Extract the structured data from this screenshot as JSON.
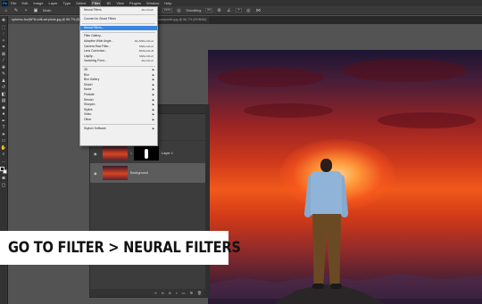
{
  "menubar": {
    "app_logo": "Ps",
    "items": [
      "File",
      "Edit",
      "Image",
      "Layer",
      "Type",
      "Select",
      "Filter",
      "3D",
      "View",
      "Plugins",
      "Window",
      "Help"
    ],
    "active_item": "Filter"
  },
  "options_bar": {
    "mode_label": "Mode:",
    "opacity_value": "100%",
    "smoothing_label": "Smoothing:",
    "smoothing_value": "0%",
    "angle_value": "0°"
  },
  "tabs": [
    {
      "label": "spfoenc-fxe(NFM-edit-serphoto.jpg @ 66.7% (Background, RGB/8#)",
      "active": true
    },
    {
      "label": "...",
      "active": false
    },
    {
      "label": "shutterstock-sampler-composite.jpg @ 66.7% (RGB/8#)",
      "active": false
    }
  ],
  "filter_menu": {
    "groups": [
      [
        {
          "label": "Neural Filters",
          "shortcut": "Alt+Ctrl+F"
        }
      ],
      [
        {
          "label": "Convert for Smart Filters",
          "shortcut": ""
        }
      ],
      [
        {
          "label": "Neural Filters...",
          "shortcut": "",
          "highlighted": true
        }
      ],
      [
        {
          "label": "Filter Gallery...",
          "shortcut": ""
        },
        {
          "label": "Adaptive Wide Angle...",
          "shortcut": "Alt+Shift+Ctrl+A"
        },
        {
          "label": "Camera Raw Filter...",
          "shortcut": "Shift+Ctrl+A"
        },
        {
          "label": "Lens Correction...",
          "shortcut": "Shift+Ctrl+R"
        },
        {
          "label": "Liquify...",
          "shortcut": "Shift+Ctrl+X"
        },
        {
          "label": "Vanishing Point...",
          "shortcut": "Alt+Ctrl+V"
        }
      ],
      [
        {
          "label": "3D",
          "submenu": true
        },
        {
          "label": "Blur",
          "submenu": true
        },
        {
          "label": "Blur Gallery",
          "submenu": true
        },
        {
          "label": "Distort",
          "submenu": true
        },
        {
          "label": "Noise",
          "submenu": true
        },
        {
          "label": "Pixelate",
          "submenu": true
        },
        {
          "label": "Render",
          "submenu": true
        },
        {
          "label": "Sharpen",
          "submenu": true
        },
        {
          "label": "Stylize",
          "submenu": true
        },
        {
          "label": "Video",
          "submenu": true
        },
        {
          "label": "Other",
          "submenu": true
        }
      ],
      [
        {
          "label": "Skylum Software",
          "submenu": true
        }
      ]
    ]
  },
  "layers": [
    {
      "name": "Layer 1",
      "selected": false
    },
    {
      "name": "Background",
      "selected": true
    }
  ],
  "caption": {
    "text": "GO TO FILTER > NEURAL FILTERS"
  },
  "colors": {
    "menu_highlight": "#3a86e0",
    "app_bg": "#535353",
    "menubar_bg": "#323232",
    "photo_sky": "#d03a1b"
  }
}
